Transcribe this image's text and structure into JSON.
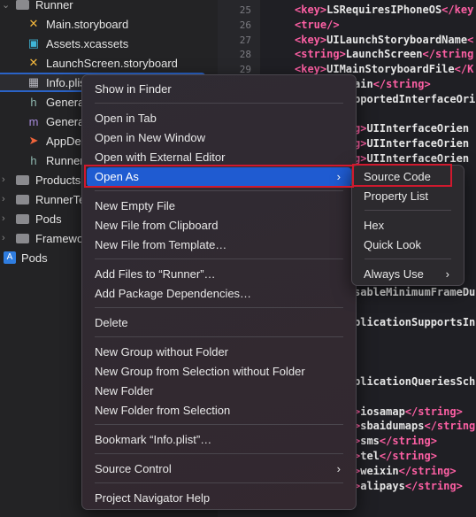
{
  "sidebar": {
    "items": [
      {
        "label": "Runner",
        "icon": "folder-icon",
        "expanded": true
      },
      {
        "label": "Main.storyboard",
        "icon": "storyboard-icon"
      },
      {
        "label": "Assets.xcassets",
        "icon": "asset-catalog-icon"
      },
      {
        "label": "LaunchScreen.storyboard",
        "icon": "storyboard-icon"
      },
      {
        "label": "Info.plis",
        "icon": "plist-icon",
        "selected": true
      },
      {
        "label": "Genera",
        "icon": "header-file-icon"
      },
      {
        "label": "Genera",
        "icon": "objc-file-icon"
      },
      {
        "label": "AppDel",
        "icon": "swift-file-icon"
      },
      {
        "label": "Runner",
        "icon": "header-file-icon"
      },
      {
        "label": "Products",
        "icon": "folder-icon"
      },
      {
        "label": "RunnerTe",
        "icon": "folder-icon"
      },
      {
        "label": "Pods",
        "icon": "folder-icon"
      },
      {
        "label": "Framewor",
        "icon": "folder-icon"
      },
      {
        "label": "Pods",
        "icon": "project-icon"
      }
    ]
  },
  "editor": {
    "line_numbers": [
      "25",
      "26",
      "27",
      "28",
      "29"
    ],
    "lines": [
      {
        "tag1": "<key>",
        "text": "LSRequiresIPhoneOS",
        "tag2": "</key"
      },
      {
        "tag1": "<true/>",
        "text": "",
        "tag2": ""
      },
      {
        "tag1": "<key>",
        "text": "UILaunchStoryboardName",
        "tag2": "<"
      },
      {
        "tag1": "<string>",
        "text": "LaunchScreen",
        "tag2": "</string"
      },
      {
        "tag1": "<key>",
        "text": "UIMainStoryboardFile",
        "tag2": "</K"
      },
      {
        "tag1": "",
        "text": "ain",
        "tag2": "</string>"
      },
      {
        "tag1": "",
        "text": "pportedInterfaceOri",
        "tag2": ""
      },
      {
        "tag1": "g>",
        "text": "UIInterfaceOrien",
        "tag2": ""
      },
      {
        "tag1": "g>",
        "text": "UIInterfaceOrien",
        "tag2": ""
      },
      {
        "tag1": "g>",
        "text": "UIInterfaceOrien",
        "tag2": ""
      },
      {
        "tag1": "",
        "text": "sableMinimumFrameDu",
        "tag2": ""
      },
      {
        "tag1": "",
        "text": "plicationSupportsIn",
        "tag2": ""
      },
      {
        "tag1": "",
        "text": "plicationQueriesSch",
        "tag2": ""
      },
      {
        "tag1": ">",
        "text": "iosamap",
        "tag2": "</string>"
      },
      {
        "tag1": ">",
        "text": "sbaidumaps",
        "tag2": "</string"
      },
      {
        "tag1": ">",
        "text": "sms",
        "tag2": "</string>"
      },
      {
        "tag1": ">",
        "text": "tel",
        "tag2": "</string>"
      },
      {
        "tag1": ">",
        "text": "weixin",
        "tag2": "</string>"
      },
      {
        "tag1": ">",
        "text": "alipays",
        "tag2": "</string>"
      }
    ]
  },
  "context_menu": {
    "items": [
      "Show in Finder",
      "Open in Tab",
      "Open in New Window",
      "Open with External Editor",
      "Open As",
      "New Empty File",
      "New File from Clipboard",
      "New File from Template…",
      "Add Files to “Runner”…",
      "Add Package Dependencies…",
      "Delete",
      "New Group without Folder",
      "New Group from Selection without Folder",
      "New Folder",
      "New Folder from Selection",
      "Bookmark “Info.plist”…",
      "Source Control",
      "Project Navigator Help"
    ],
    "highlighted": "Open As"
  },
  "submenu": {
    "items": [
      "Source Code",
      "Property List",
      "Hex",
      "Quick Look",
      "Always Use"
    ]
  },
  "colors": {
    "highlight": "#1f5bd1",
    "annotation": "#d0192e",
    "xml_tag": "#fc5fa3"
  }
}
